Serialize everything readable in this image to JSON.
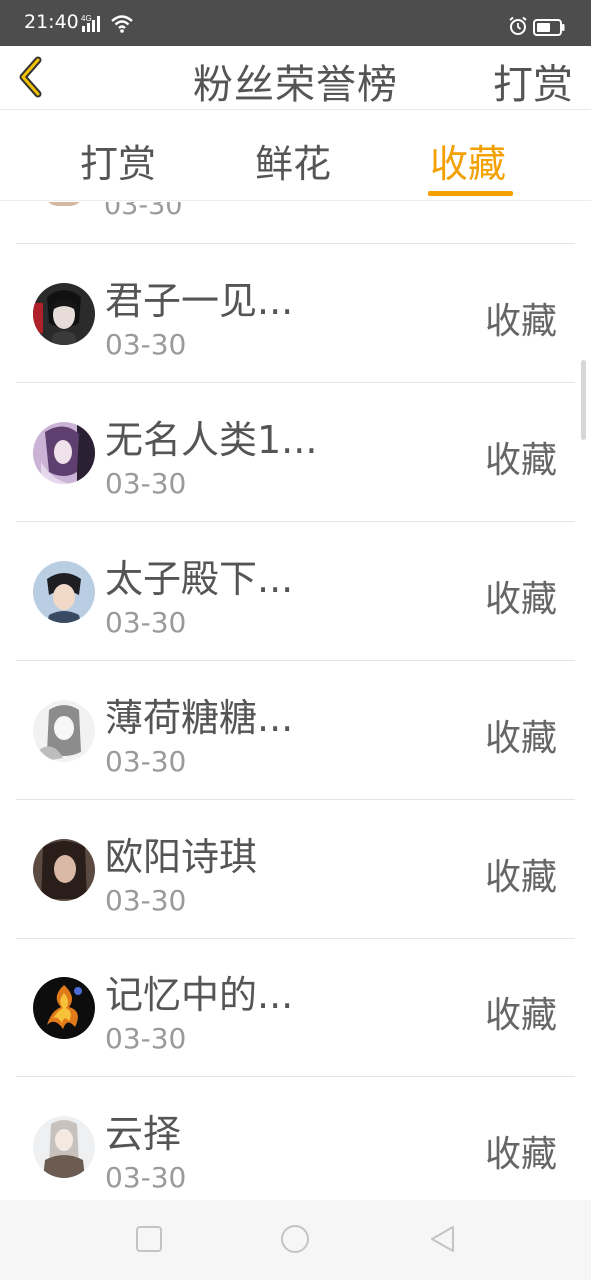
{
  "status_bar": {
    "time": "21:40",
    "network": "4G"
  },
  "header": {
    "title": "粉丝荣誉榜",
    "right_action": "打赏"
  },
  "tabs": [
    {
      "label": "打赏",
      "active": false
    },
    {
      "label": "鲜花",
      "active": false
    },
    {
      "label": "收藏",
      "active": true
    }
  ],
  "accent_color": "#f2a100",
  "list": {
    "partial_top_date": "03-30",
    "items": [
      {
        "name": "君子一见...",
        "date": "03-30",
        "action": "收藏"
      },
      {
        "name": "无名人类1...",
        "date": "03-30",
        "action": "收藏"
      },
      {
        "name": "太子殿下...",
        "date": "03-30",
        "action": "收藏"
      },
      {
        "name": "薄荷糖糖...",
        "date": "03-30",
        "action": "收藏"
      },
      {
        "name": "欧阳诗琪",
        "date": "03-30",
        "action": "收藏"
      },
      {
        "name": "记忆中的...",
        "date": "03-30",
        "action": "收藏"
      },
      {
        "name": "云择",
        "date": "03-30",
        "action": "收藏"
      }
    ]
  }
}
